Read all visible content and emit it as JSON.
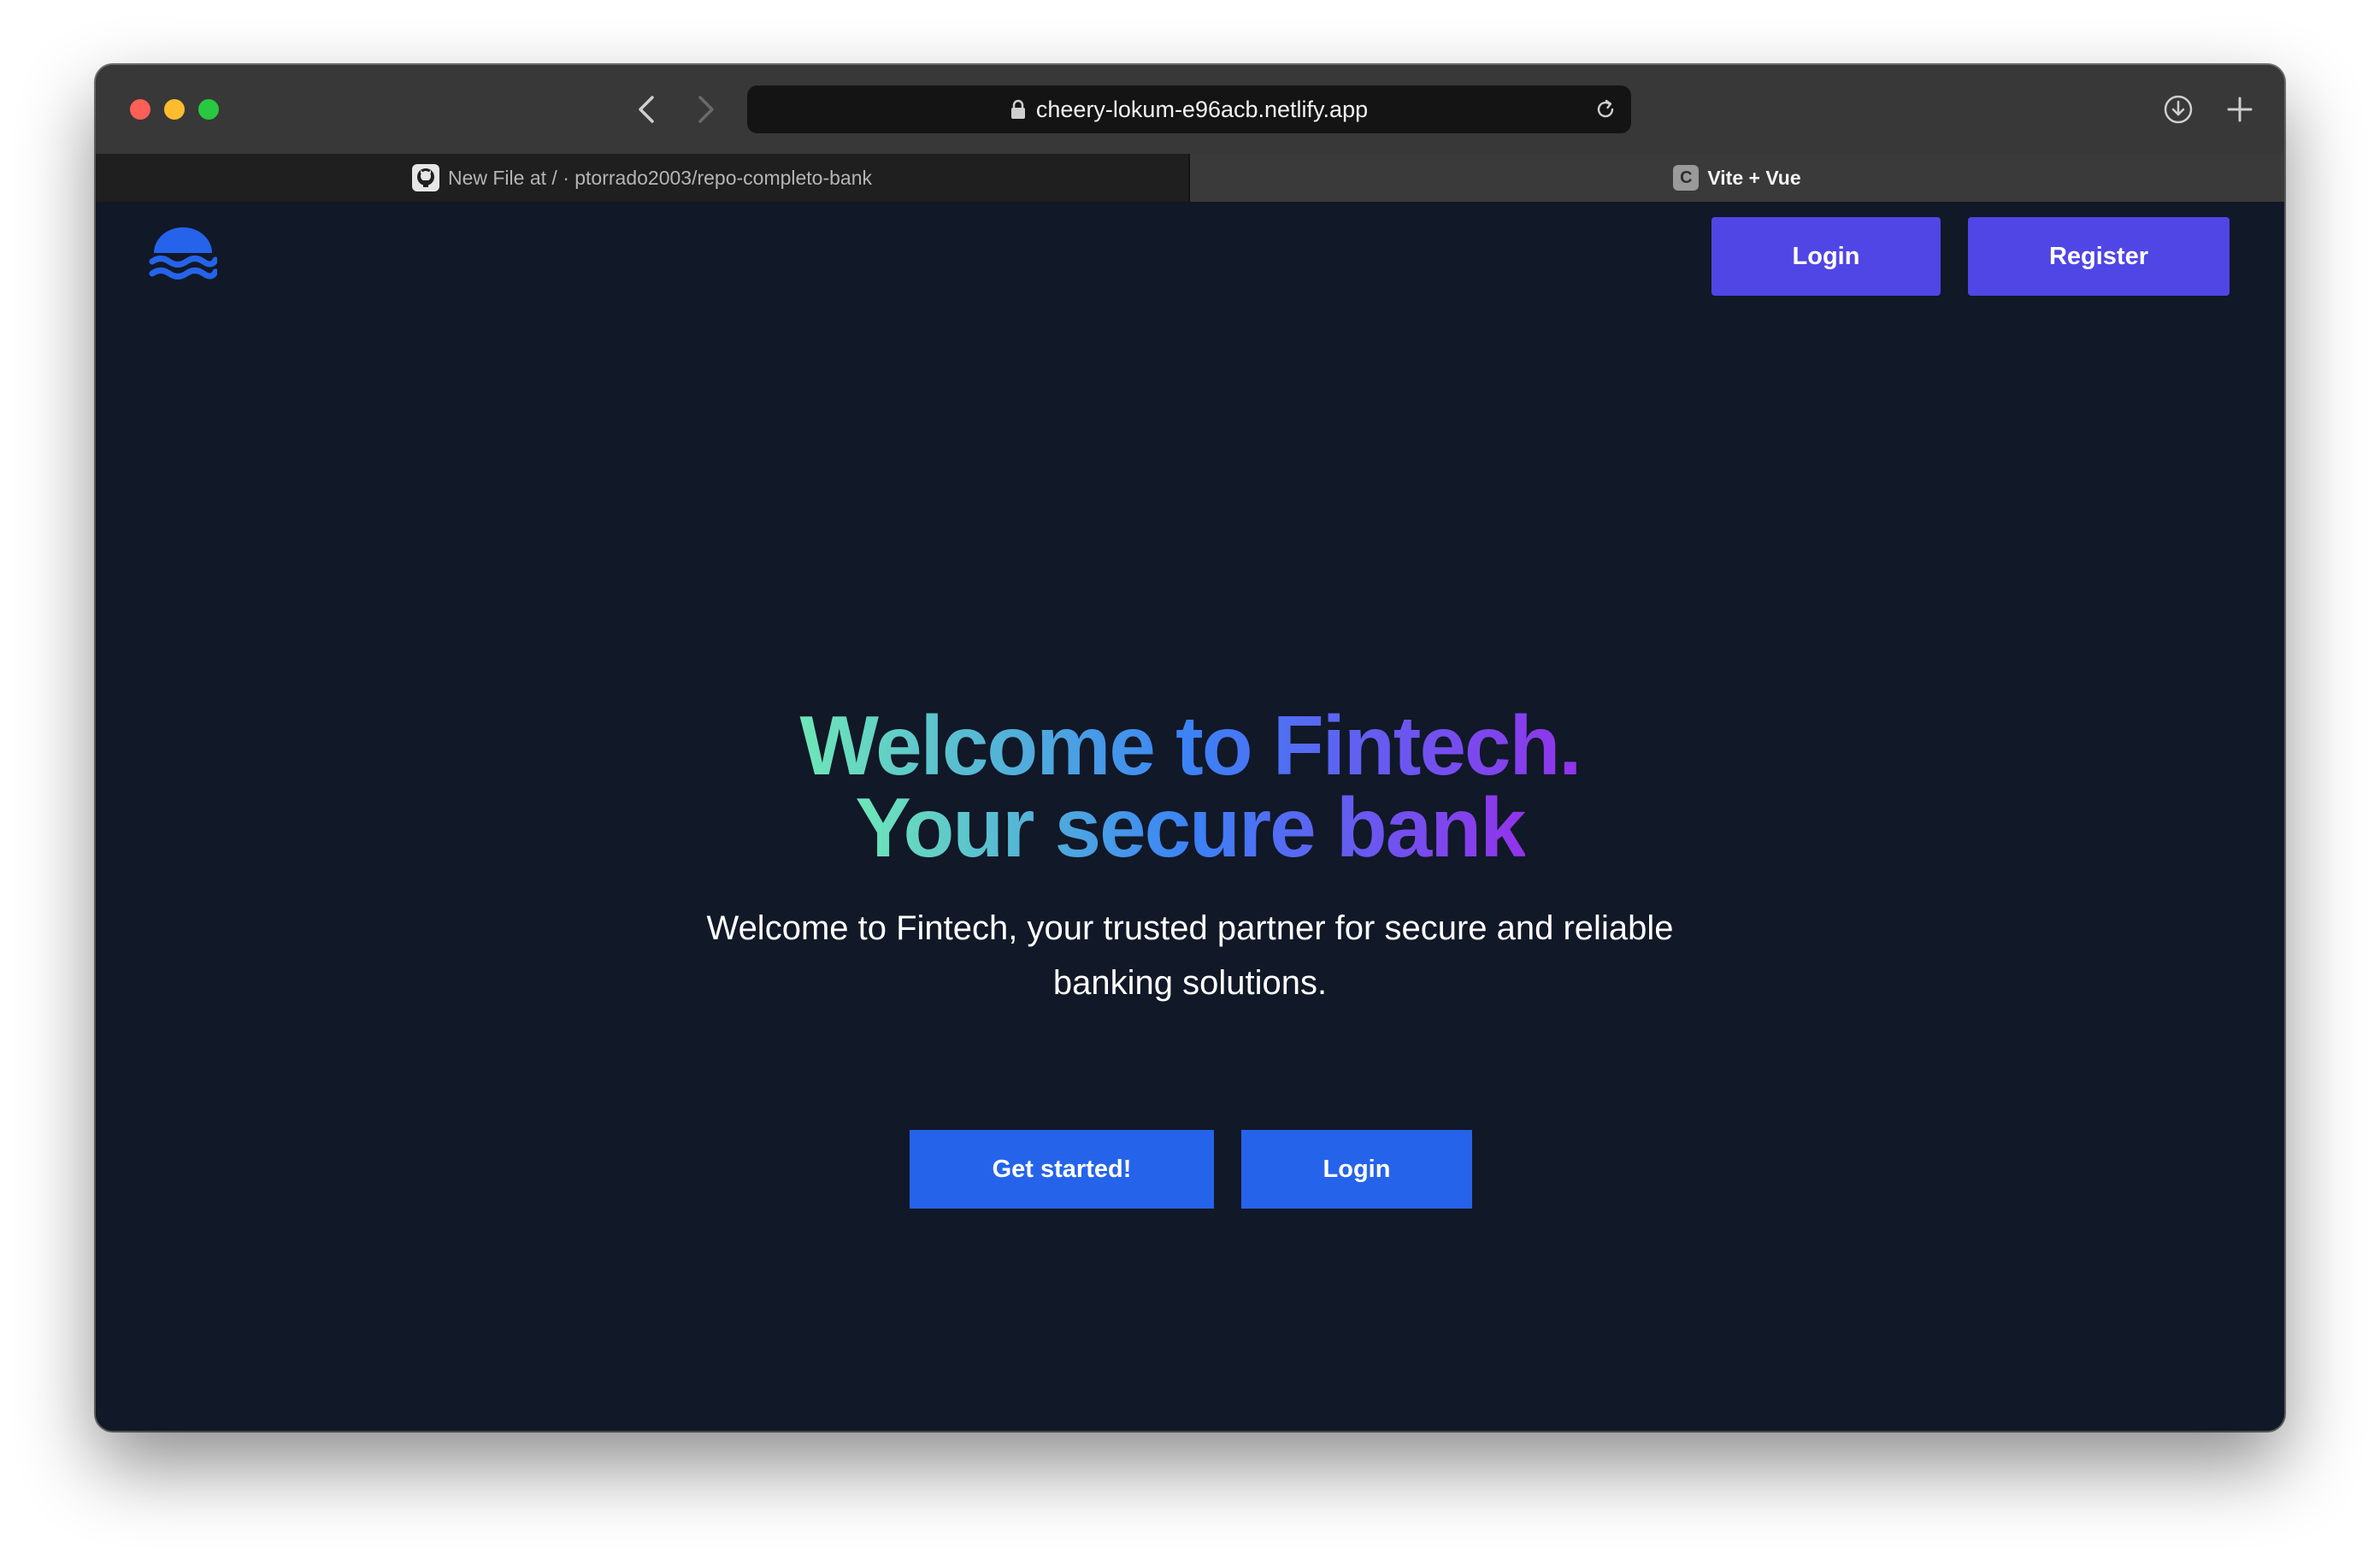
{
  "browser": {
    "url": "cheery-lokum-e96acb.netlify.app",
    "tabs": [
      {
        "label": "New File at / · ptorrado2003/repo-completo-bank",
        "favicon": "github-icon",
        "active": false
      },
      {
        "label": "Vite + Vue",
        "favicon_letter": "C",
        "active": true
      }
    ]
  },
  "header": {
    "logo": "waves-logo-icon",
    "login_label": "Login",
    "register_label": "Register"
  },
  "hero": {
    "title_line1": "Welcome to Fintech.",
    "title_line2": "Your secure bank",
    "subtitle": "Welcome to Fintech, your trusted partner for secure and reliable banking solutions.",
    "get_started_label": "Get started!",
    "login_label": "Login"
  },
  "colors": {
    "page_background": "#111827",
    "nav_button": "#4f46e5",
    "cta_button": "#2563eb",
    "logo": "#2563eb",
    "title_gradient": [
      "#6ee7b7",
      "#3b82f6",
      "#9333ea"
    ]
  }
}
